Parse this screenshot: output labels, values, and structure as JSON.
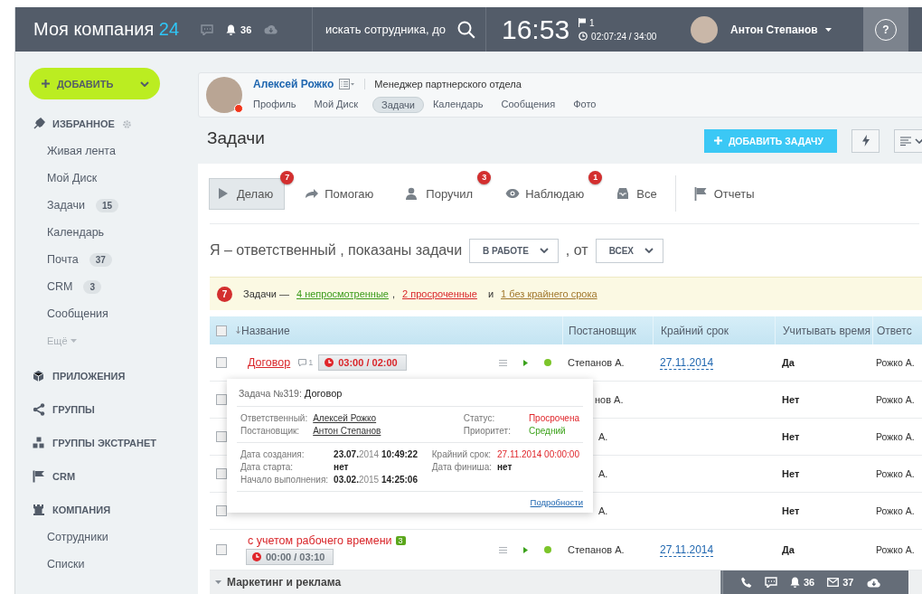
{
  "header": {
    "logo": "Моя компания",
    "logo_suffix": "24",
    "notifications": "36",
    "search_placeholder": "искать сотрудника, до",
    "clock": "16:53",
    "flags": "1",
    "work_time": "02:07:24 / 34:00",
    "user": "Антон Степанов",
    "help": "?"
  },
  "sidebar": {
    "add_button": "ДОБАВИТЬ",
    "sections": [
      {
        "title": "ИЗБРАННОЕ",
        "settings": true,
        "items": [
          {
            "label": "Живая лента"
          },
          {
            "label": "Мой Диск"
          },
          {
            "label": "Задачи",
            "count": "15"
          },
          {
            "label": "Календарь"
          },
          {
            "label": "Почта",
            "count": "37"
          },
          {
            "label": "CRM",
            "count": "3"
          },
          {
            "label": "Сообщения"
          }
        ],
        "more": "Ещё"
      },
      {
        "title": "ПРИЛОЖЕНИЯ"
      },
      {
        "title": "ГРУППЫ"
      },
      {
        "title": "ГРУППЫ ЭКСТРАНЕТ"
      },
      {
        "title": "CRM"
      },
      {
        "title": "КОМПАНИЯ",
        "items": [
          {
            "label": "Сотрудники"
          },
          {
            "label": "Списки"
          }
        ]
      }
    ]
  },
  "profile": {
    "name": "Алексей Рожко",
    "online": false,
    "position": "Менеджер партнерского отдела",
    "tabs": [
      {
        "label": "Профиль",
        "selected": false
      },
      {
        "label": "Мой Диск",
        "selected": false
      },
      {
        "label": "Задачи",
        "selected": true
      },
      {
        "label": "Календарь",
        "selected": false
      },
      {
        "label": "Сообщения",
        "selected": false
      },
      {
        "label": "Фото",
        "selected": false
      }
    ]
  },
  "page_title": "Задачи",
  "add_task_button": "ДОБАВИТЬ ЗАДАЧУ",
  "role_tabs": [
    {
      "label": "Делаю",
      "selected": true,
      "count": "7"
    },
    {
      "label": "Помогаю",
      "selected": false
    },
    {
      "label": "Поручил",
      "selected": false,
      "count": "3"
    },
    {
      "label": "Наблюдаю",
      "selected": false,
      "count": "1"
    },
    {
      "label": "Все",
      "selected": false
    },
    {
      "label": "Отчеты",
      "selected": false
    }
  ],
  "filter": {
    "text": "Я – ответственный , показаны задачи",
    "status": "В РАБОТЕ",
    "separator": ", от",
    "from": "ВСЕХ"
  },
  "notice": {
    "count": "7",
    "text": "Задачи —",
    "links": [
      {
        "label": "4 непросмотренные",
        "color": "#3b9a1b"
      },
      {
        "label": "2 просроченные",
        "color": "#d9262a"
      },
      {
        "label": "1 без крайнего срока",
        "color": "#a0762b"
      }
    ],
    "comma": ",",
    "and": "и"
  },
  "table": {
    "all_checked": false,
    "columns": [
      "Название",
      "Постановщик",
      "Крайний срок",
      "Учитывать время",
      "Ответс"
    ],
    "rows": [
      {
        "kind": "task",
        "checked": false,
        "title": "Договор",
        "hovered": true,
        "comments": "1",
        "timer": "03:00 / 02:00",
        "overdue": true,
        "creator": "Степанов А.",
        "deadline": "27.11.2014",
        "track_time": "Да",
        "responsible": "Рожко А."
      },
      {
        "kind": "covered",
        "checked": false,
        "creator": "нов А.",
        "track_time": "Нет",
        "responsible": "Рожко А."
      },
      {
        "kind": "covered",
        "checked": false,
        "creator": "А.",
        "track_time": "Нет",
        "responsible": "Рожко А."
      },
      {
        "kind": "covered",
        "checked": false,
        "creator": "А.",
        "track_time": "Нет",
        "responsible": "Рожко А."
      },
      {
        "kind": "covered",
        "checked": false,
        "creator": "А.",
        "track_time": "Нет",
        "responsible": "Рожко А."
      },
      {
        "kind": "task",
        "checked": false,
        "title": "с учетом рабочего времени",
        "hovered": false,
        "subtasks": "3",
        "timer": "00:00 / 03:10",
        "overdue": false,
        "creator": "Степанов А.",
        "deadline": "27.11.2014",
        "track_time": "Да",
        "responsible": "Рожко А."
      }
    ],
    "group": "Маркетинг и реклама"
  },
  "popup": {
    "label": "Задача №319:",
    "title": "Договор",
    "people": [
      {
        "label": "Ответственный:",
        "value": "Алексей Рожко"
      },
      {
        "label": "Постановщик:",
        "value": "Антон Степанов"
      }
    ],
    "state": [
      {
        "label": "Статус:",
        "value": "Просрочена",
        "color": "#e0262b"
      },
      {
        "label": "Приоритет:",
        "value": "Средний",
        "color": "#3ca21b"
      }
    ],
    "dates_left": [
      {
        "label": "Дата создания:",
        "value": "**23.07.**2014 **10:49:22**"
      },
      {
        "label": "Дата старта:",
        "value": "**нет**"
      },
      {
        "label": "Начало выполнения:",
        "value": "**03.02.**2015 **14:25:06**"
      }
    ],
    "dates_right": [
      {
        "label": "Крайний срок:",
        "value": "27.11.2014 00:00:00",
        "overdue": true
      },
      {
        "label": "Дата финиша:",
        "value": "нет",
        "overdue": false
      }
    ],
    "more": "Подробности"
  },
  "bottom_bar": {
    "notifications": "36",
    "mail": "37"
  }
}
